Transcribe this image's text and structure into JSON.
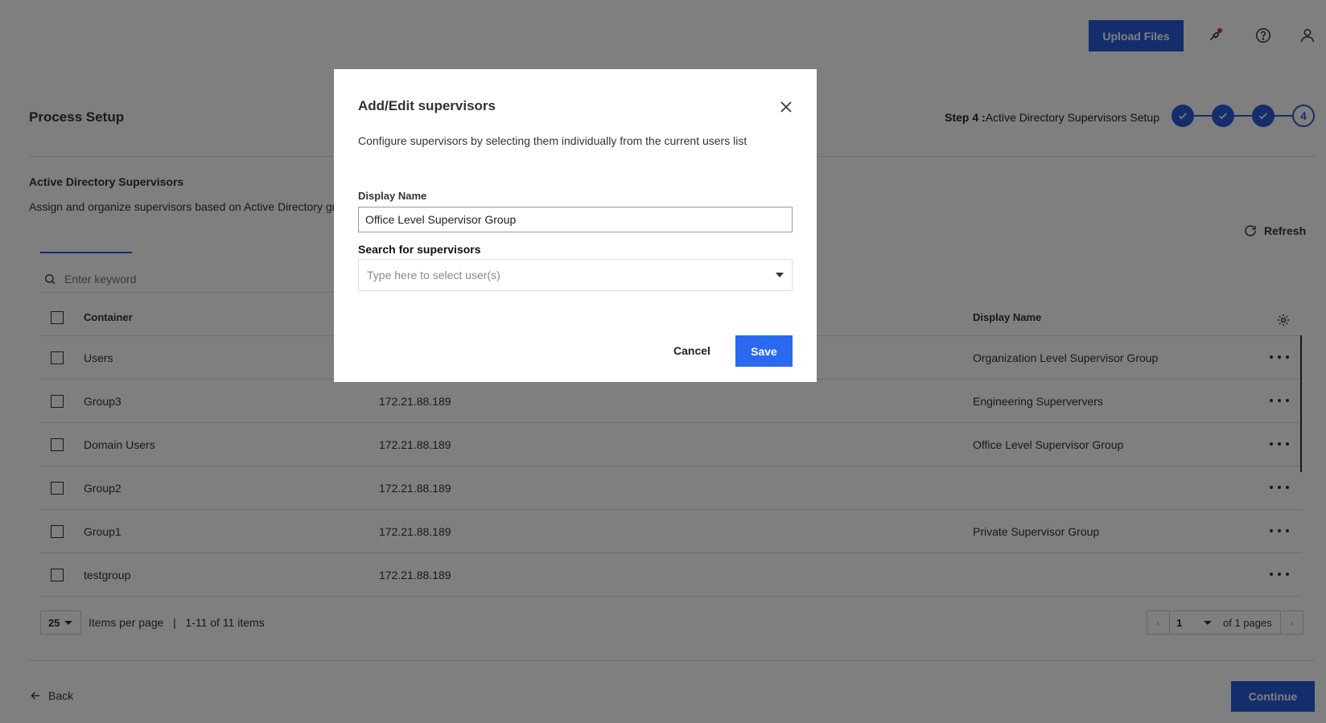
{
  "header": {
    "upload_label": "Upload Files",
    "icons": [
      "notification-icon",
      "help-icon",
      "user-icon"
    ]
  },
  "process": {
    "title": "Process Setup",
    "step_prefix": "Step 4 :",
    "step_label": "Active Directory Supervisors Setup",
    "steps": [
      "done",
      "done",
      "done",
      "4"
    ],
    "current_step": "4"
  },
  "section": {
    "title": "Active Directory Supervisors",
    "description": "Assign and organize supervisors based on Active Directory group"
  },
  "toolbar": {
    "refresh_label": "Refresh",
    "search_placeholder": "Enter keyword"
  },
  "table": {
    "columns": {
      "container": "Container",
      "ip": "",
      "display_name": "Display Name"
    },
    "rows": [
      {
        "container": "Users",
        "ip": "",
        "display_name": "Organization Level Supervisor Group"
      },
      {
        "container": "Group3",
        "ip": "172.21.88.189",
        "display_name": "Engineering Superververs"
      },
      {
        "container": "Domain Users",
        "ip": "172.21.88.189",
        "display_name": "Office Level Supervisor Group"
      },
      {
        "container": "Group2",
        "ip": "172.21.88.189",
        "display_name": ""
      },
      {
        "container": "Group1",
        "ip": "172.21.88.189",
        "display_name": "Private Supervisor Group"
      },
      {
        "container": "testgroup",
        "ip": "172.21.88.189",
        "display_name": ""
      }
    ]
  },
  "pagination": {
    "per_page": "25",
    "per_page_label": "Items per page",
    "separator": "|",
    "range_label": "1-11 of 11 items",
    "current_page": "1",
    "of_pages": "of 1 pages"
  },
  "footer": {
    "back_label": "Back",
    "continue_label": "Continue"
  },
  "modal": {
    "title": "Add/Edit supervisors",
    "description": "Configure supervisors by selecting them individually from the current users list",
    "display_name_label": "Display Name",
    "display_name_value": "Office Level Supervisor Group",
    "search_label": "Search for supervisors",
    "search_placeholder": "Type here to select user(s)",
    "cancel_label": "Cancel",
    "save_label": "Save"
  },
  "colors": {
    "accent": "#2a5bd7",
    "save": "#2a6af0",
    "overlay": "rgba(0,0,0,0.5)"
  }
}
